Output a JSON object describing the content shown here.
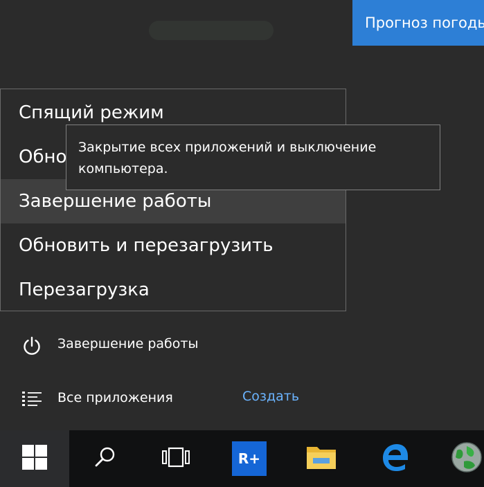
{
  "weather_tile": {
    "label": "Прогноз погоды"
  },
  "power_menu": {
    "items": [
      {
        "label": "Спящий режим"
      },
      {
        "label": "Обновить и завершить работу"
      },
      {
        "label": "Завершение работы"
      },
      {
        "label": "Обновить и перезагрузить"
      },
      {
        "label": "Перезагрузка"
      }
    ]
  },
  "tooltip": {
    "lines": [
      "Закрытие всех приложений и выключение",
      "компьютера."
    ]
  },
  "power_button": {
    "label": "Завершение работы",
    "icon": "power-icon"
  },
  "all_apps": {
    "label": "Все приложения",
    "icon": "list-icon"
  },
  "create_link": {
    "label": "Создать",
    "color": "#6bb4ff"
  },
  "taskbar": {
    "items": [
      {
        "icon": "windows-logo-icon"
      },
      {
        "icon": "search-icon"
      },
      {
        "icon": "task-view-icon"
      },
      {
        "icon": "rplus-app-icon",
        "label": "R+"
      },
      {
        "icon": "file-explorer-icon"
      },
      {
        "icon": "edge-icon"
      },
      {
        "icon": "globe-icon"
      }
    ]
  },
  "colors": {
    "accent": "#2d7fd6",
    "menu_bg": "#2b2b2b",
    "selected_bg": "#3f3f3f",
    "taskbar_bg": "#101112"
  }
}
